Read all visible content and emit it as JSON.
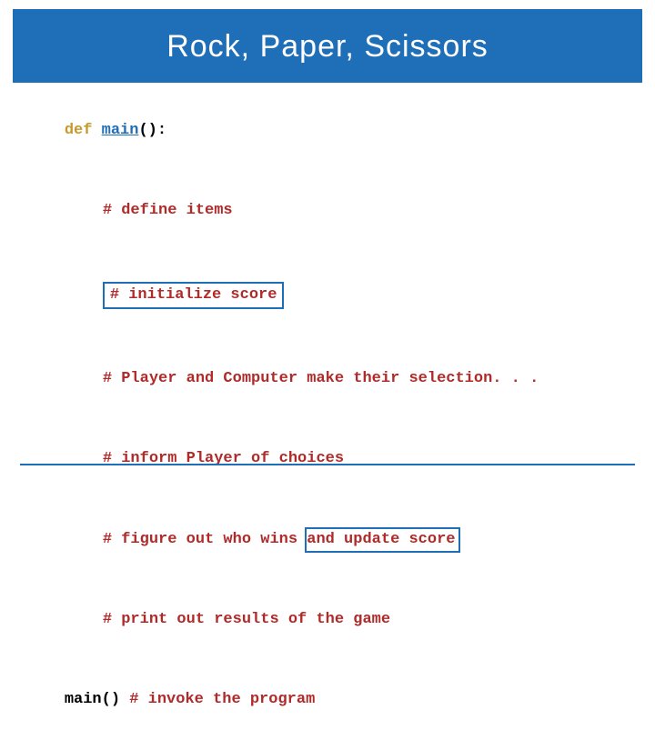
{
  "title": "Rock, Paper, Scissors",
  "code": {
    "kw_def": "def",
    "fn_main": "main",
    "parens_colon": "():",
    "c1": "# define items",
    "c2": "# initialize score",
    "c3": "# Player and Computer make their selection. . .",
    "c4": "# inform Player of choices",
    "c5_a": "# figure out who wins ",
    "c5_b": "and update score",
    "c6": "# print out results of the game",
    "invoke_call": "main()",
    "invoke_cmt": " # invoke the program"
  }
}
